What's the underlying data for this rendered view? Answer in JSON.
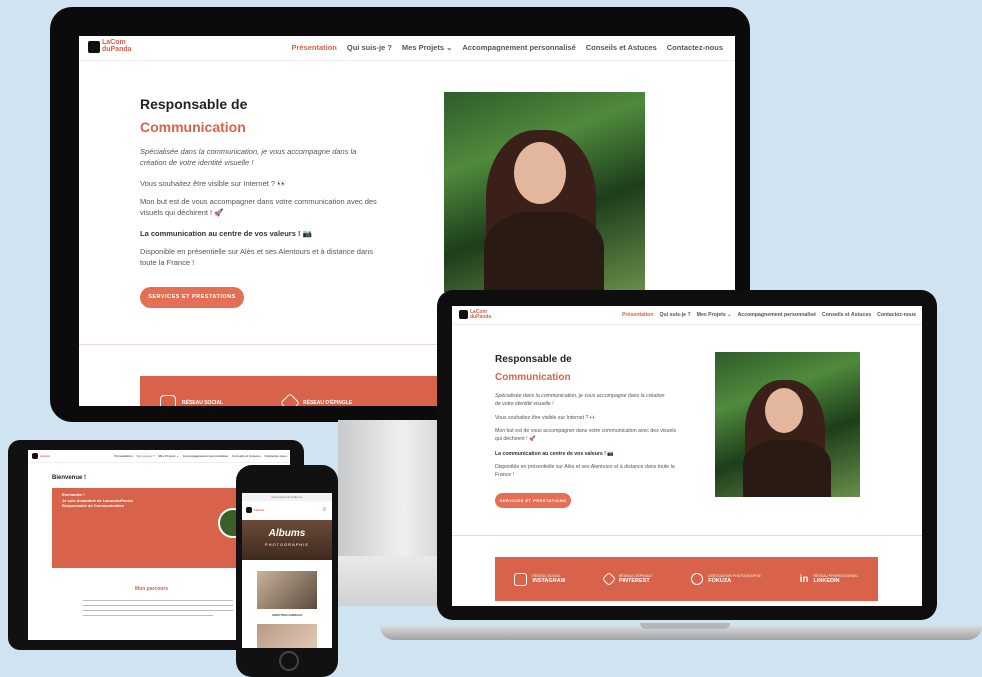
{
  "brand": {
    "logo_line1": "LaCom",
    "logo_line2": "duPanda"
  },
  "colors": {
    "accent": "#d9634a",
    "button": "#e56f55"
  },
  "nav": {
    "items": [
      {
        "label": "Présentation",
        "active": true
      },
      {
        "label": "Qui suis-je ?"
      },
      {
        "label": "Mes Projets ⌄"
      },
      {
        "label": "Accompagnement personnalisé"
      },
      {
        "label": "Conseils et Astuces"
      },
      {
        "label": "Contactez-nous"
      }
    ]
  },
  "hero": {
    "title_line1": "Responsable de",
    "title_line2": "Communication",
    "intro": "Spécialisée dans la communication, je vous accompagne dans la création de votre identité visuelle !",
    "p1": "Vous souhaitez être visible sur Internet ? 👀",
    "p2": "Mon but est de vous accompagner dans votre communication avec des visuels qui déchirent ! 🚀",
    "p3": "La communication au centre de vos valeurs ! 📷",
    "p4": "Disponible en présentielle sur Alès et ses Alentours et à distance dans toute la France !",
    "button": "SERVICES ET PRESTATIONS"
  },
  "socials": [
    {
      "small": "RÉSEAU SOCIAL",
      "label": "INSTAGRAM",
      "icon": "instagram-icon"
    },
    {
      "small": "RÉSEAU D'ÉPINGLE",
      "label": "PINTEREST",
      "icon": "tag-icon"
    },
    {
      "small": "ASSOCIATION PHOTOGRAPHIE",
      "label": "FOKUZA",
      "icon": "aperture-icon"
    },
    {
      "small": "RÉSEAU PROFESSIONNEL",
      "label": "LINKEDIN",
      "icon": "linkedin-icon"
    }
  ],
  "tablet": {
    "heading": "Bienvenue !",
    "card_line1": "Enchantée !",
    "card_line2": "Je suis Amandine de LacomduPanda.",
    "card_line3": "Responsable de Communication",
    "section": "Mon parcours"
  },
  "phone": {
    "url": "lacomdupanda.fr/albums",
    "hero_title": "Albums",
    "hero_sub": "PHOTOGRAPHIE",
    "caption": "ADOPTION ANIMAUX"
  }
}
